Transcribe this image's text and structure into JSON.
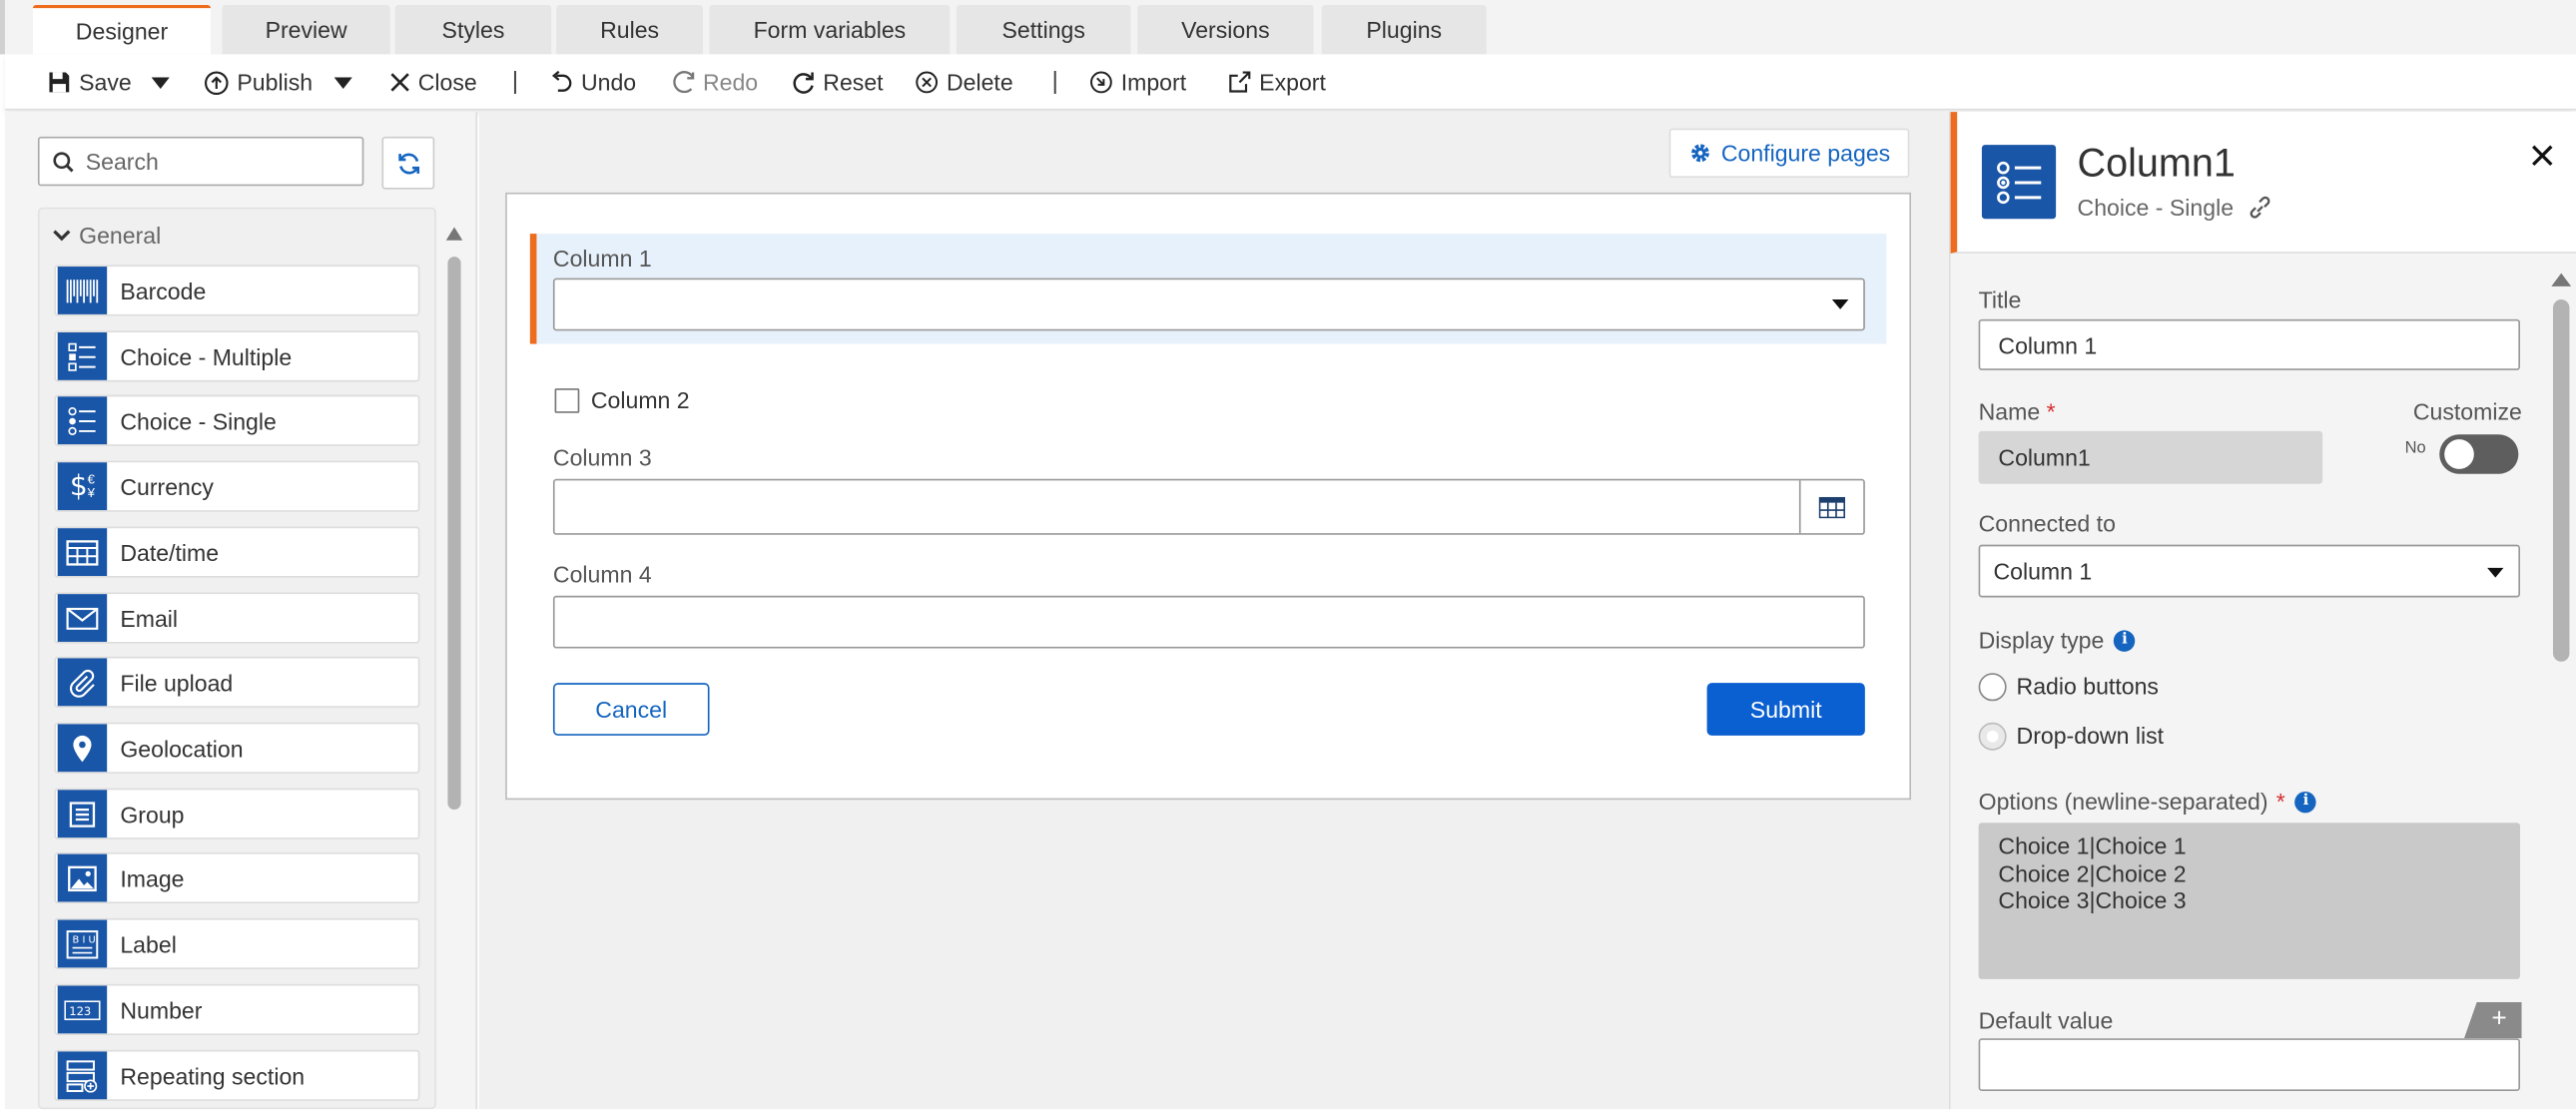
{
  "tabs": [
    "Designer",
    "Preview",
    "Styles",
    "Rules",
    "Form variables",
    "Settings",
    "Versions",
    "Plugins"
  ],
  "toolbar": {
    "save": "Save",
    "publish": "Publish",
    "close": "Close",
    "undo": "Undo",
    "redo": "Redo",
    "reset": "Reset",
    "delete": "Delete",
    "import": "Import",
    "export": "Export"
  },
  "left": {
    "search_placeholder": "Search",
    "group": "General",
    "controls": [
      {
        "label": "Barcode",
        "icon": "barcode-icon"
      },
      {
        "label": "Choice - Multiple",
        "icon": "choice-multiple-icon"
      },
      {
        "label": "Choice - Single",
        "icon": "choice-single-icon"
      },
      {
        "label": "Currency",
        "icon": "currency-icon"
      },
      {
        "label": "Date/time",
        "icon": "datetime-icon"
      },
      {
        "label": "Email",
        "icon": "email-icon"
      },
      {
        "label": "File upload",
        "icon": "paperclip-icon"
      },
      {
        "label": "Geolocation",
        "icon": "map-pin-icon"
      },
      {
        "label": "Group",
        "icon": "group-icon"
      },
      {
        "label": "Image",
        "icon": "image-icon"
      },
      {
        "label": "Label",
        "icon": "label-icon"
      },
      {
        "label": "Number",
        "icon": "number-icon"
      },
      {
        "label": "Repeating section",
        "icon": "repeating-section-icon"
      }
    ]
  },
  "canvas": {
    "configure_pages": "Configure pages",
    "fields": {
      "col1": "Column 1",
      "col2": "Column 2",
      "col3": "Column 3",
      "col4": "Column 4"
    },
    "cancel": "Cancel",
    "submit": "Submit"
  },
  "props": {
    "title": "Column1",
    "subtitle": "Choice - Single",
    "title_label": "Title",
    "title_value": "Column 1",
    "name_label": "Name",
    "name_value": "Column1",
    "customize_label": "Customize",
    "customize_state": "No",
    "connected_label": "Connected to",
    "connected_value": "Column 1",
    "display_type_label": "Display type",
    "radio_buttons": "Radio buttons",
    "dropdown_list": "Drop-down list",
    "options_label": "Options (newline-separated)",
    "options": [
      "Choice 1|Choice 1",
      "Choice 2|Choice 2",
      "Choice 3|Choice 3"
    ],
    "default_value_label": "Default value"
  },
  "colors": {
    "accent": "#ee6c1e",
    "primary": "#0a5fd1",
    "icon_bg": "#1a56a7"
  }
}
